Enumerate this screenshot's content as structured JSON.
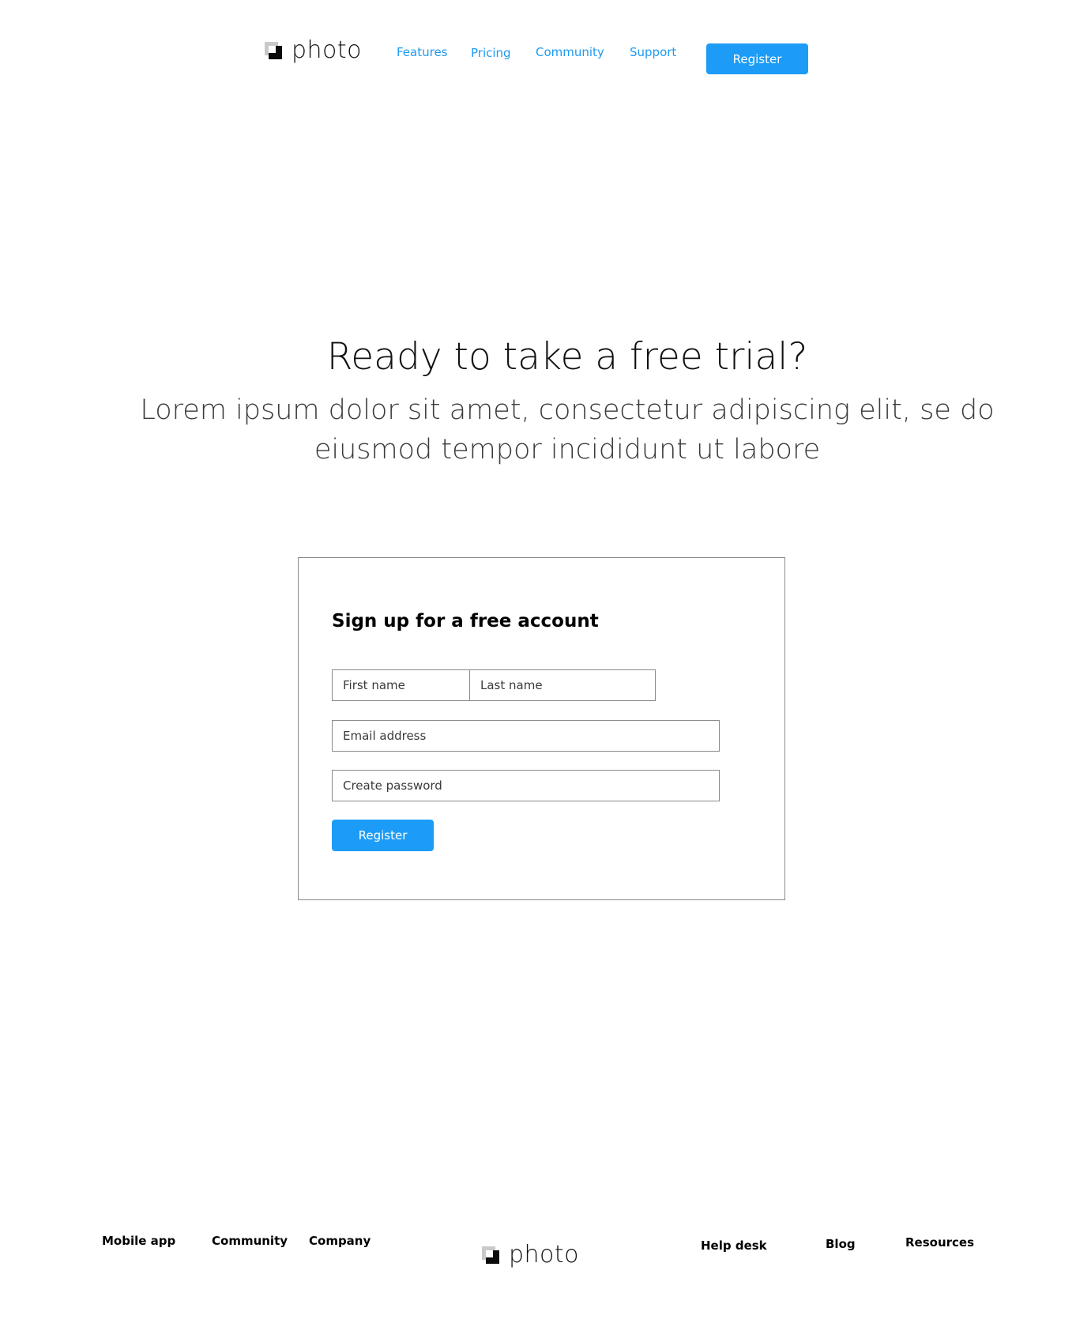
{
  "header": {
    "logo_text": "photo",
    "nav": [
      {
        "label": "Features"
      },
      {
        "label": "Pricing"
      },
      {
        "label": "Community"
      },
      {
        "label": "Support"
      }
    ],
    "register_label": "Register"
  },
  "hero": {
    "title": "Ready to take a free trial?",
    "subtitle": "Lorem ipsum dolor sit amet, consectetur adipiscing elit, se do eiusmod tempor incididunt ut labore"
  },
  "signup": {
    "title": "Sign up for a free account",
    "first_name_placeholder": "First name",
    "last_name_placeholder": "Last name",
    "email_placeholder": "Email address",
    "password_placeholder": "Create password",
    "register_label": "Register"
  },
  "footer": {
    "links_left": [
      "Mobile app",
      "Community",
      "Company"
    ],
    "logo_text": "photo",
    "links_right": [
      "Help desk",
      "Blog",
      "Resources"
    ]
  },
  "colors": {
    "accent": "#1c9cf6",
    "nav_link": "#1d9bf0",
    "text": "#111111",
    "border": "#8a8a8a"
  }
}
